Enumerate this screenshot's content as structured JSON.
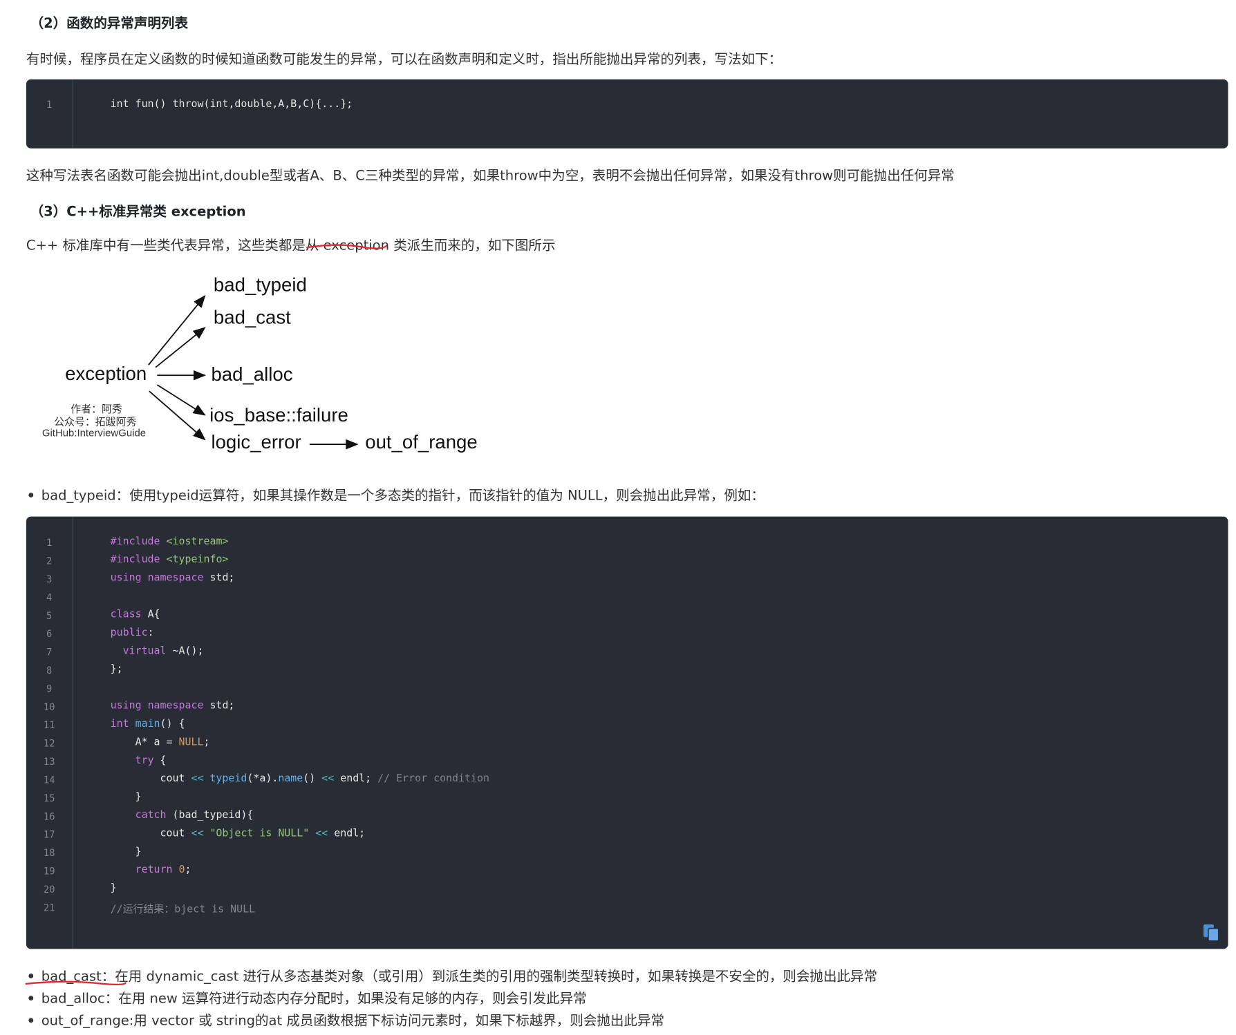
{
  "heading2": "（2）函数的异常声明列表",
  "para1": "有时候，程序员在定义函数的时候知道函数可能发生的异常，可以在函数声明和定义时，指出所能抛出异常的列表，写法如下：",
  "code1": {
    "lines": [
      {
        "n": "1",
        "text": "int fun() throw(int,double,A,B,C){...};"
      }
    ]
  },
  "para2": "这种写法表名函数可能会抛出int,double型或者A、B、C三种类型的异常，如果throw中为空，表明不会抛出任何异常，如果没有throw则可能抛出任何异常",
  "heading3": "（3）C++标准异常类 exception",
  "para3": "C++ 标准库中有一些类代表异常，这些类都是从 exception 类派生而来的，如下图所示",
  "diagram": {
    "root": "exception",
    "children": [
      "bad_typeid",
      "bad_cast",
      "bad_alloc",
      "ios_base::failure",
      "logic_error"
    ],
    "grandchild": "out_of_range",
    "watermark": [
      "作者：阿秀",
      "公众号：拓跋阿秀",
      "GitHub:InterviewGuide"
    ]
  },
  "bullet1": "bad_typeid：使用typeid运算符，如果其操作数是一个多态类的指针，而该指针的值为 NULL，则会抛出此异常，例如：",
  "code2": {
    "line_numbers": [
      "1",
      "2",
      "3",
      "4",
      "5",
      "6",
      "7",
      "8",
      "9",
      "10",
      "11",
      "12",
      "13",
      "14",
      "15",
      "16",
      "17",
      "18",
      "19",
      "20",
      "21"
    ],
    "lines": [
      "#include <iostream>",
      "#include <typeinfo>",
      "using namespace std;",
      "",
      "class A{",
      "public:",
      "  virtual ~A();",
      "};",
      "",
      "using namespace std;",
      "int main() {",
      "    A* a = NULL;",
      "    try {",
      "        cout << typeid(*a).name() << endl; // Error condition",
      "    }",
      "    catch (bad_typeid){",
      "        cout << \"Object is NULL\" << endl;",
      "    }",
      "    return 0;",
      "}",
      "//运行结果：bject is NULL"
    ],
    "copy_icon": "copy-icon"
  },
  "bullets": [
    "bad_cast：在用 dynamic_cast 进行从多态基类对象（或引用）到派生类的引用的强制类型转换时，如果转换是不安全的，则会抛出此异常",
    "bad_alloc：在用 new 运算符进行动态内存分配时，如果没有足够的内存，则会引发此异常",
    "out_of_range:用 vector 或 string的at 成员函数根据下标访问元素时，如果下标越界，则会抛出此异常"
  ],
  "colors": {
    "code_bg": "#282c34",
    "keyword": "#c678dd",
    "string": "#98c379",
    "number": "#d19a66",
    "comment": "#7f848e",
    "annotation": "#e0262f"
  }
}
